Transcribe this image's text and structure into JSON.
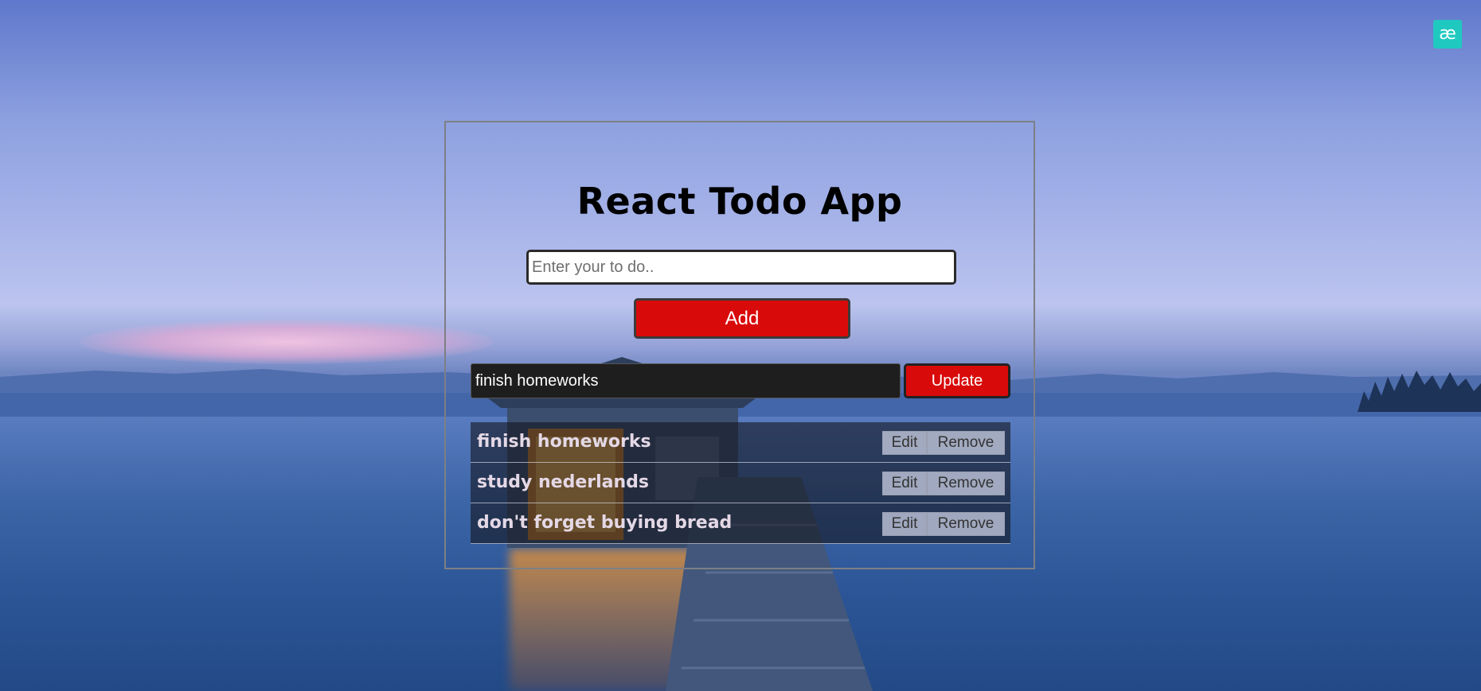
{
  "app": {
    "title": "React Todo App",
    "brand_badge": "æ"
  },
  "new_todo": {
    "placeholder": "Enter your to do..",
    "value": ""
  },
  "buttons": {
    "add_label": "Add",
    "update_label": "Update",
    "edit_label": "Edit",
    "remove_label": "Remove"
  },
  "edit_todo": {
    "value": "finish homeworks"
  },
  "todos": [
    {
      "text": "finish homeworks"
    },
    {
      "text": "study nederlands"
    },
    {
      "text": "don't forget buying bread"
    }
  ],
  "colors": {
    "accent_red": "#d90a0a",
    "brand_teal": "#1fc9c0",
    "edit_field_bg": "#1e1e1e"
  },
  "icons": {
    "brand": "ae-ligature-badge-icon"
  }
}
